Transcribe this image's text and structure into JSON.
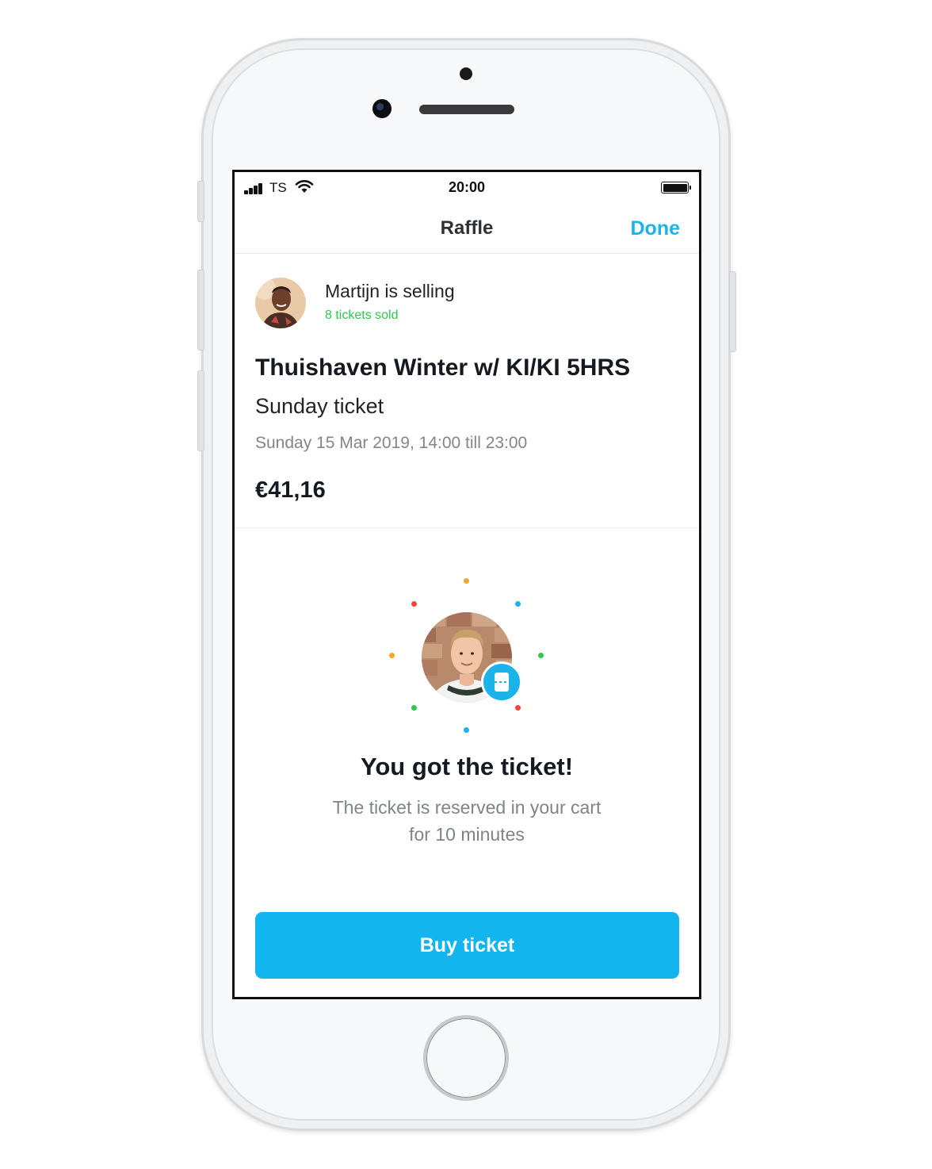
{
  "status_bar": {
    "carrier": "TS",
    "time": "20:00"
  },
  "navbar": {
    "title": "Raffle",
    "done_label": "Done"
  },
  "seller": {
    "name_text": "Martijn is selling",
    "tickets_sold": "8 tickets sold"
  },
  "event": {
    "title": "Thuishaven Winter w/ KI/KI 5HRS",
    "ticket_type": "Sunday ticket",
    "date": "Sunday 15 Mar 2019, 14:00 till 23:00",
    "price": "€41,16"
  },
  "result": {
    "title": "You got the ticket!",
    "line1": "The ticket is reserved in your cart",
    "line2": "for 10 minutes"
  },
  "buy_button": {
    "label": "Buy ticket"
  },
  "colors": {
    "accent": "#1bb3ea",
    "sold_green": "#2dc84d",
    "confetti": [
      "#f5a623",
      "#1bb3ea",
      "#2dc84d",
      "#f0473a"
    ]
  }
}
